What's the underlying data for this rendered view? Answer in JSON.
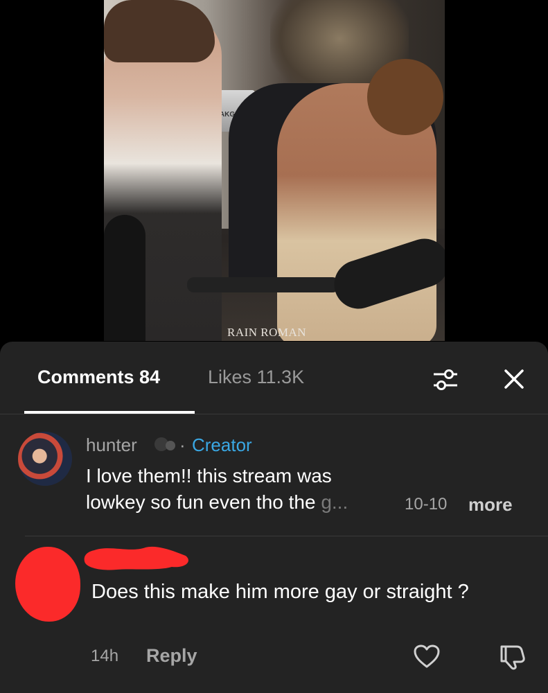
{
  "video": {
    "watermark": "RAIN ROMAN",
    "equipment_label": "AKG"
  },
  "tabs": {
    "comments": "Comments 84",
    "likes": "Likes 11.3K"
  },
  "icons": {
    "filter": "sliders-icon",
    "close": "close-icon",
    "heart": "heart-icon",
    "dislike": "thumbs-down-icon"
  },
  "comments": [
    {
      "username": "hunter",
      "separator": "·",
      "badge": "Creator",
      "text_line1": "I love them!! this stream was",
      "text_line2": "lowkey so fun even tho the ",
      "text_trunc": "g...",
      "date": "10-10",
      "more": "more"
    },
    {
      "text": "Does this make him more gay or straight ?",
      "time": "14h",
      "reply": "Reply"
    }
  ],
  "colors": {
    "sheet_bg": "#232323",
    "creator_blue": "#3aa8e4",
    "redaction": "#fb2a2a"
  }
}
